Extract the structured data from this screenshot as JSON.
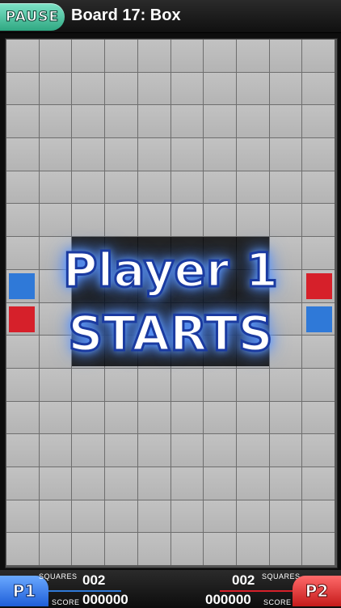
{
  "header": {
    "pause_label": "PAUSE",
    "title": "Board 17: Box"
  },
  "board": {
    "columns": 10,
    "rows": 16
  },
  "overlay": {
    "line1": "Player 1",
    "line2": "STARTS"
  },
  "markers": {
    "left": [
      "blue",
      "red"
    ],
    "right": [
      "red",
      "blue"
    ]
  },
  "colors": {
    "blue": "#2f79d8",
    "red": "#d6202a",
    "pause": "#3fb892"
  },
  "footer": {
    "p1": {
      "badge": "P1",
      "squares_label": "SQUARES",
      "squares": "002",
      "score_label": "SCORE",
      "score": "000000"
    },
    "p2": {
      "badge": "P2",
      "squares_label": "SQUARES",
      "squares": "002",
      "score_label": "SCORE",
      "score": "000000"
    }
  }
}
